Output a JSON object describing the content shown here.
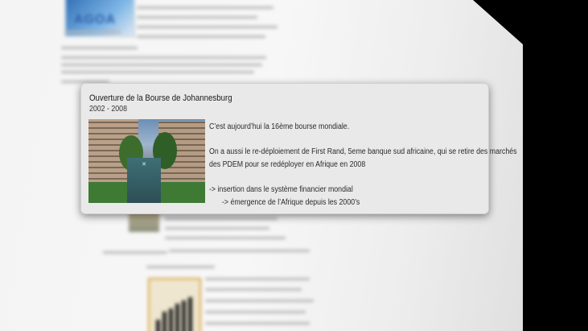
{
  "background_page": {
    "logo_text": "AGOA"
  },
  "popup": {
    "title": "Ouverture de la Bourse de Johannesburg",
    "period": "2002 - 2008",
    "photo_alt": "Johannesburg Stock Exchange building",
    "lines": [
      "C’est aujourd’hui la 16ème bourse mondiale.",
      "On a aussi le re-déploiement de First Rand, 5eme banque sud africaine, qui se retire des marchés",
      "des PDEM pour se redéployer en Afrique en 2008",
      "-> insertion dans le système financier mondial",
      "-> émergence de l’Afrique depuis les 2000’s"
    ]
  }
}
